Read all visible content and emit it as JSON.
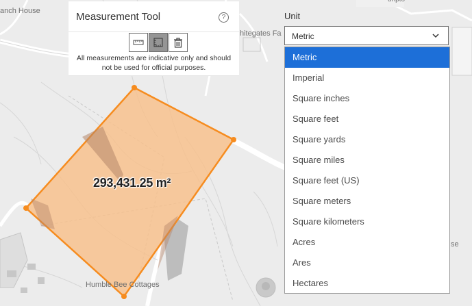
{
  "map": {
    "labels": {
      "ranch": "anch House",
      "whitegates": "hitegates Fa",
      "humble": "Humble Bee Cottages",
      "topright": "unpto",
      "rightedge": "se"
    },
    "measurement": {
      "area_label": "293,431.25 m²",
      "fill_color": "#f8c08a",
      "stroke_color": "#f68c1f"
    }
  },
  "panel": {
    "title": "Measurement Tool",
    "help_icon": "question-circle-icon",
    "tools": [
      {
        "icon": "ruler-distance-icon",
        "active": false
      },
      {
        "icon": "area-measure-icon",
        "active": true
      },
      {
        "icon": "trash-icon",
        "active": false
      }
    ],
    "disclaimer": "All measurements are indicative only and should not be used for official purposes."
  },
  "unit": {
    "label": "Unit",
    "selected": "Metric",
    "options": [
      "Metric",
      "Imperial",
      "Square inches",
      "Square feet",
      "Square yards",
      "Square miles",
      "Square feet (US)",
      "Square meters",
      "Square kilometers",
      "Acres",
      "Ares",
      "Hectares"
    ],
    "accent": "#1d6fd8"
  }
}
